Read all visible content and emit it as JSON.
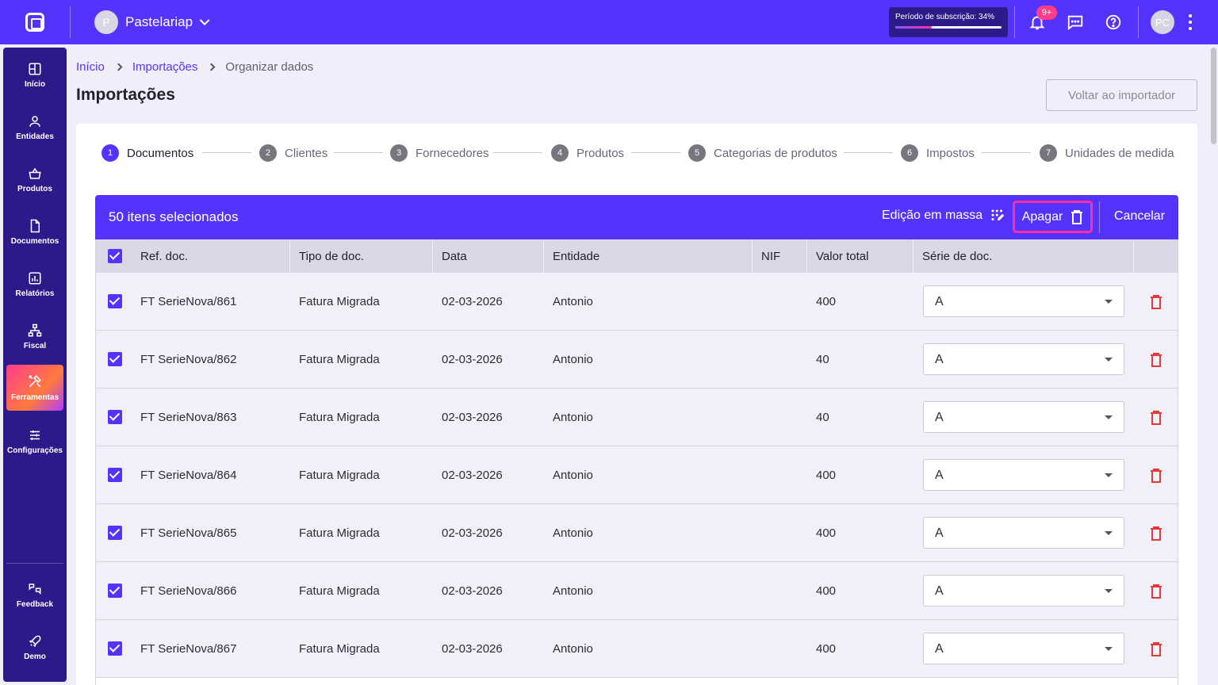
{
  "company": {
    "initial": "P",
    "name": "Pastelariap"
  },
  "subscription": {
    "label": "Período de subscrição: 34%",
    "percent": 34
  },
  "notifications": {
    "badge": "9+"
  },
  "user": {
    "initials": "PC"
  },
  "sidebar": {
    "items": [
      {
        "label": "Início",
        "icon": "grid-icon"
      },
      {
        "label": "Entidades",
        "icon": "person-icon"
      },
      {
        "label": "Produtos",
        "icon": "basket-icon"
      },
      {
        "label": "Documentos",
        "icon": "document-icon"
      },
      {
        "label": "Relatórios",
        "icon": "chart-icon"
      },
      {
        "label": "Fiscal",
        "icon": "hierarchy-icon"
      },
      {
        "label": "Ferramentas",
        "icon": "tools-icon",
        "active": true
      },
      {
        "label": "Configurações",
        "icon": "sliders-icon"
      }
    ],
    "bottom": [
      {
        "label": "Feedback",
        "icon": "feedback-icon"
      },
      {
        "label": "Demo",
        "icon": "rocket-icon"
      }
    ]
  },
  "breadcrumb": [
    "Início",
    "Importações",
    "Organizar dados"
  ],
  "page": {
    "title": "Importações",
    "back_button": "Voltar ao importador"
  },
  "steps": [
    {
      "num": "1",
      "label": "Documentos",
      "active": true
    },
    {
      "num": "2",
      "label": "Clientes"
    },
    {
      "num": "3",
      "label": "Fornecedores"
    },
    {
      "num": "4",
      "label": "Produtos"
    },
    {
      "num": "5",
      "label": "Categorias de produtos"
    },
    {
      "num": "6",
      "label": "Impostos"
    },
    {
      "num": "7",
      "label": "Unidades de medida"
    }
  ],
  "selection": {
    "count_label": "50 itens selecionados",
    "bulk_edit": "Edição em massa",
    "delete": "Apagar",
    "cancel": "Cancelar"
  },
  "table": {
    "headers": [
      "Ref. doc.",
      "Tipo de doc.",
      "Data",
      "Entidade",
      "NIF",
      "Valor total",
      "Série de doc."
    ],
    "rows": [
      {
        "ref": "FT SerieNova/861",
        "tipo": "Fatura Migrada",
        "data": "02-03-2026",
        "entidade": "Antonio",
        "nif": "",
        "valor": "400",
        "serie": "A"
      },
      {
        "ref": "FT SerieNova/862",
        "tipo": "Fatura Migrada",
        "data": "02-03-2026",
        "entidade": "Antonio",
        "nif": "",
        "valor": "40",
        "serie": "A"
      },
      {
        "ref": "FT SerieNova/863",
        "tipo": "Fatura Migrada",
        "data": "02-03-2026",
        "entidade": "Antonio",
        "nif": "",
        "valor": "40",
        "serie": "A"
      },
      {
        "ref": "FT SerieNova/864",
        "tipo": "Fatura Migrada",
        "data": "02-03-2026",
        "entidade": "Antonio",
        "nif": "",
        "valor": "400",
        "serie": "A"
      },
      {
        "ref": "FT SerieNova/865",
        "tipo": "Fatura Migrada",
        "data": "02-03-2026",
        "entidade": "Antonio",
        "nif": "",
        "valor": "400",
        "serie": "A"
      },
      {
        "ref": "FT SerieNova/866",
        "tipo": "Fatura Migrada",
        "data": "02-03-2026",
        "entidade": "Antonio",
        "nif": "",
        "valor": "400",
        "serie": "A"
      },
      {
        "ref": "FT SerieNova/867",
        "tipo": "Fatura Migrada",
        "data": "02-03-2026",
        "entidade": "Antonio",
        "nif": "",
        "valor": "400",
        "serie": "A"
      }
    ]
  },
  "colors": {
    "brand": "#5533ff",
    "sidebar": "#2b1a8a",
    "danger": "#e53935",
    "highlight": "#ff2fa0"
  }
}
